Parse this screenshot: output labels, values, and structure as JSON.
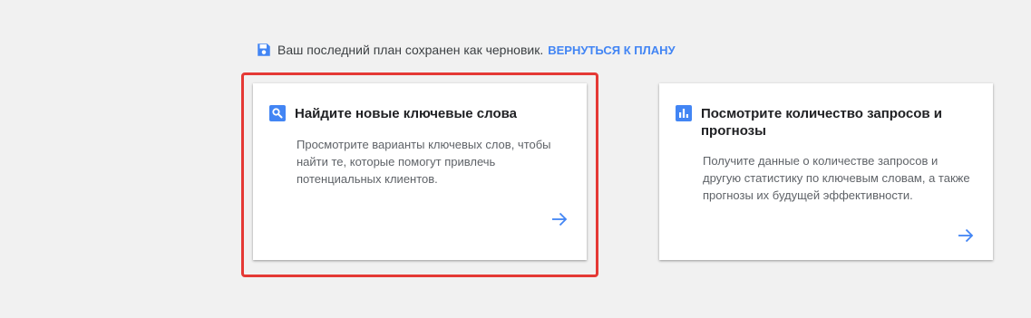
{
  "notice": {
    "icon": "save-icon",
    "text": "Ваш последний план сохранен как черновик.",
    "link_label": "ВЕРНУТЬСЯ К ПЛАНУ"
  },
  "cards": [
    {
      "icon": "search-icon",
      "title": "Найдите новые ключевые слова",
      "description": "Просмотрите варианты ключевых слов, чтобы найти те, которые помогут привлечь потенциальных клиентов.",
      "arrow": "arrow-right-icon"
    },
    {
      "icon": "bar-chart-icon",
      "title": "Посмотрите количество запросов и прогнозы",
      "description": "Получите данные о количестве запросов и другую статистику по ключевым словам, а также прогнозы их будущей эффективности.",
      "arrow": "arrow-right-icon"
    }
  ],
  "colors": {
    "accent": "#4285f4",
    "highlight_border": "#e53935",
    "background": "#f1f1f1"
  }
}
